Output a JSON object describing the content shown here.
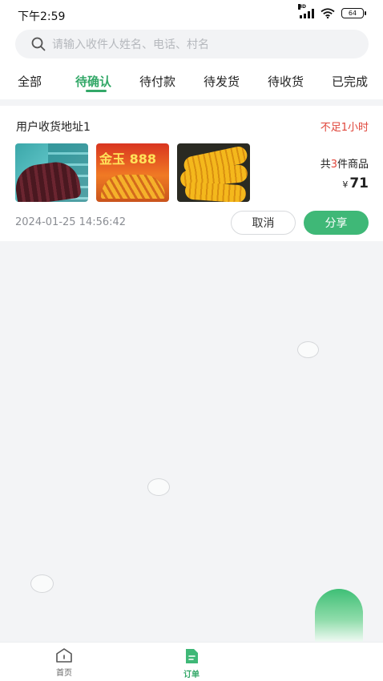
{
  "status_bar": {
    "time": "下午2:59",
    "network": "HD",
    "battery": "64"
  },
  "search": {
    "placeholder": "请输入收件人姓名、电话、村名"
  },
  "tabs": [
    {
      "label": "全部",
      "active": false
    },
    {
      "label": "待确认",
      "active": true
    },
    {
      "label": "待付款",
      "active": false
    },
    {
      "label": "待发货",
      "active": false
    },
    {
      "label": "待收货",
      "active": false
    },
    {
      "label": "已完成",
      "active": false
    }
  ],
  "order": {
    "address": "用户收货地址1",
    "timer": "不足1小时",
    "products": [
      {
        "icon": "product-image-purple-corn"
      },
      {
        "icon": "product-image-seed-bag",
        "brand": "金玉 888"
      },
      {
        "icon": "product-image-yellow-corn"
      }
    ],
    "count_prefix": "共",
    "count": "3",
    "count_suffix": "件商品",
    "currency": "¥",
    "price": "71",
    "created_at": "2024-01-25 14:56:42",
    "cancel_label": "取消",
    "share_label": "分享"
  },
  "bottom_nav": [
    {
      "label": "首页",
      "icon": "home-icon",
      "active": false
    },
    {
      "label": "订单",
      "icon": "orders-icon",
      "active": true
    }
  ],
  "colors": {
    "accent": "#33a868",
    "alert": "#e0453a",
    "background": "#f3f4f6"
  }
}
